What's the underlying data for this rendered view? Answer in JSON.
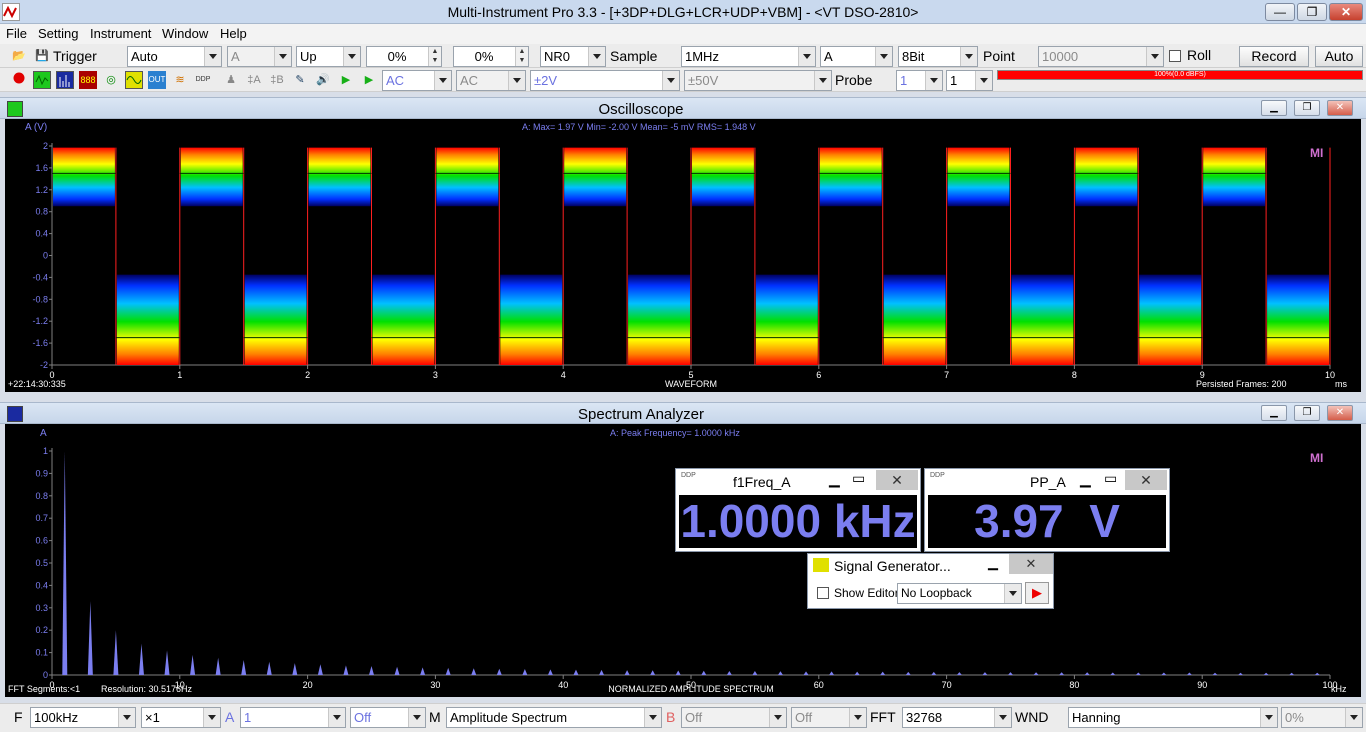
{
  "window": {
    "title": "Multi-Instrument Pro 3.3   -   [+3DP+DLG+LCR+UDP+VBM]   -   <VT DSO-2810>"
  },
  "menu": [
    "File",
    "Setting",
    "Instrument",
    "Window",
    "Help"
  ],
  "toolbar1": {
    "trigger_label": "Trigger",
    "trigger_mode": "Auto",
    "trigger_channel": "A",
    "trigger_edge": "Up",
    "trigger_level": "0%",
    "trigger_delay": "0%",
    "filter": "NR0",
    "sample_label": "Sample",
    "sample_rate": "1MHz",
    "channel": "A",
    "bits": "8Bit",
    "point_label": "Point",
    "point_value": "10000",
    "roll_label": "Roll",
    "record_label": "Record",
    "auto_label": "Auto"
  },
  "toolbar2": {
    "coupling_a": "AC",
    "coupling_b": "AC",
    "range_a": "±2V",
    "range_b": "±50V",
    "probe_label": "Probe",
    "probe_a": "1",
    "probe_b": "1",
    "level_text": "100%(0.0 dBFS)",
    "level_fraction": 1.0
  },
  "oscilloscope": {
    "title": "Oscilloscope",
    "y_axis_label": "A (V)",
    "stats": "A: Max=    1.97    V  Min=   -2.00    V  Mean=        -5 mV  RMS=    1.948    V",
    "timestamp": "+22:14:30:335",
    "footer_label": "WAVEFORM",
    "persisted": "Persisted Frames: 200",
    "unit": "ms",
    "logo": "MI",
    "chart_data": {
      "type": "line",
      "xlim": [
        0,
        10
      ],
      "ylim": [
        -2,
        2
      ],
      "x_ticks": [
        "0",
        "1",
        "2",
        "3",
        "4",
        "5",
        "6",
        "7",
        "8",
        "9",
        "10"
      ],
      "y_ticks": [
        "2",
        "1.6",
        "1.2",
        "0.8",
        "0.4",
        "0",
        "-0.4",
        "-0.8",
        "-1.2",
        "-1.6",
        "-2"
      ],
      "series": [
        {
          "period_ms": 1.0,
          "high_v": 1.97,
          "low_v": -2.0
        }
      ],
      "grid": false
    }
  },
  "spectrum": {
    "title": "Spectrum Analyzer",
    "y_axis_label": "A",
    "peak": "A: Peak Frequency=      1.0000   kHz",
    "fft_segments": "FFT Segments:<1",
    "resolution": "Resolution: 30.5176Hz",
    "footer_label": "NORMALIZED AMPLITUDE SPECTRUM",
    "unit": "kHz",
    "logo": "MI",
    "chart_data": {
      "type": "bar",
      "xlim": [
        0,
        100
      ],
      "ylim": [
        0,
        1
      ],
      "x_ticks": [
        "0",
        "10",
        "20",
        "30",
        "40",
        "50",
        "60",
        "70",
        "80",
        "90",
        "100"
      ],
      "y_ticks": [
        "1",
        "0.9",
        "0.8",
        "0.7",
        "0.6",
        "0.5",
        "0.4",
        "0.3",
        "0.2",
        "0.1",
        "0"
      ],
      "x": [
        1,
        3,
        5,
        7,
        9,
        11,
        13,
        15,
        17,
        19,
        21,
        23,
        25,
        27,
        29,
        31,
        33,
        35,
        37,
        39,
        41,
        43,
        45,
        47,
        49,
        51,
        53,
        55,
        57,
        59,
        61,
        63,
        65,
        67,
        69,
        71,
        73,
        75,
        77,
        79,
        81,
        83,
        85,
        87,
        89,
        91,
        93,
        95,
        97,
        99
      ],
      "values": [
        1.0,
        0.33,
        0.2,
        0.14,
        0.11,
        0.09,
        0.077,
        0.067,
        0.059,
        0.053,
        0.048,
        0.043,
        0.04,
        0.037,
        0.034,
        0.032,
        0.03,
        0.028,
        0.027,
        0.025,
        0.024,
        0.023,
        0.022,
        0.021,
        0.02,
        0.019,
        0.018,
        0.018,
        0.017,
        0.016,
        0.016,
        0.015,
        0.015,
        0.014,
        0.014,
        0.013,
        0.013,
        0.013,
        0.012,
        0.012,
        0.012,
        0.011,
        0.011,
        0.011,
        0.011,
        0.01,
        0.01,
        0.01,
        0.01,
        0.01
      ]
    }
  },
  "meters": {
    "freq_title": "f1Freq_A",
    "freq_value": "1.0000 kHz",
    "pp_title": "PP_A",
    "pp_value": "3.97  V"
  },
  "siggen": {
    "title": "Signal Generator...",
    "show_editor": "Show Editor",
    "loopback": "No Loopback"
  },
  "statusbar": {
    "f_label": "F",
    "f_value": "100kHz",
    "zoom": "×1",
    "a_label": "A",
    "a_value": "1",
    "a_mode": "Off",
    "m_label": "M",
    "m_value": "Amplitude Spectrum",
    "b_label": "B",
    "b_value": "Off",
    "b_mode": "Off",
    "fft_label": "FFT",
    "fft_value": "32768",
    "wnd_label": "WND",
    "wnd_value": "Hanning",
    "pct_value": "0%"
  },
  "colors": {
    "trace_blue": "#7b7ef0",
    "background": "#000000",
    "axis_label": "#7b7ef0"
  }
}
